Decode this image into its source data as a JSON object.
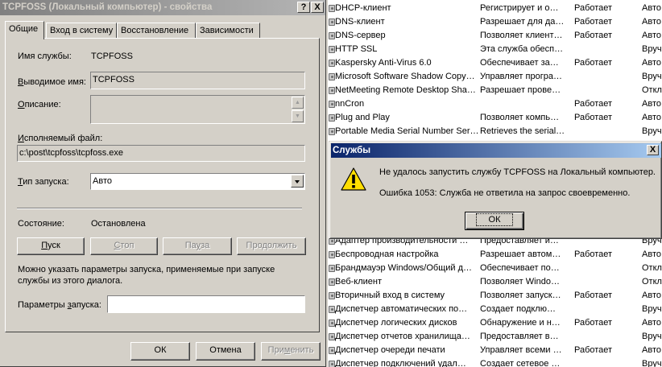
{
  "services": {
    "rows": [
      {
        "name": "DHCP-клиент",
        "desc": "Регистрирует и о…",
        "state": "Работает",
        "start": "Авто"
      },
      {
        "name": "DNS-клиент",
        "desc": "Разрешает для да…",
        "state": "Работает",
        "start": "Авто"
      },
      {
        "name": "DNS-сервер",
        "desc": "Позволяет клиент…",
        "state": "Работает",
        "start": "Авто"
      },
      {
        "name": "HTTP SSL",
        "desc": "Эта служба обесп…",
        "state": "",
        "start": "Вруч"
      },
      {
        "name": "Kaspersky Anti-Virus 6.0",
        "desc": "Обеспечивает за…",
        "state": "Работает",
        "start": "Авто"
      },
      {
        "name": "Microsoft Software Shadow Copy…",
        "desc": "Управляет програ…",
        "state": "",
        "start": "Вруч"
      },
      {
        "name": "NetMeeting Remote Desktop Sha…",
        "desc": "Разрешает прове…",
        "state": "",
        "start": "Откл"
      },
      {
        "name": "nnCron",
        "desc": "",
        "state": "Работает",
        "start": "Авто"
      },
      {
        "name": "Plug and Play",
        "desc": "Позволяет компь…",
        "state": "Работает",
        "start": "Авто"
      },
      {
        "name": "Portable Media Serial Number Ser…",
        "desc": "Retrieves the serial…",
        "state": "",
        "start": "Вруч"
      }
    ],
    "rows_bottom": [
      {
        "name": "Адаптер производительности …",
        "desc": "Предоставляет и…",
        "state": "",
        "start": "Вруч"
      },
      {
        "name": "Беспроводная настройка",
        "desc": "Разрешает автом…",
        "state": "Работает",
        "start": "Авто"
      },
      {
        "name": "Брандмауэр Windows/Общий д…",
        "desc": "Обеспечивает по…",
        "state": "",
        "start": "Откл"
      },
      {
        "name": "Веб-клиент",
        "desc": "Позволяет Windo…",
        "state": "",
        "start": "Откл"
      },
      {
        "name": "Вторичный вход в систему",
        "desc": "Позволяет запуск…",
        "state": "Работает",
        "start": "Авто"
      },
      {
        "name": "Диспетчер автоматических по…",
        "desc": "Создает подклю…",
        "state": "",
        "start": "Вруч"
      },
      {
        "name": "Диспетчер логических дисков",
        "desc": "Обнаружение и н…",
        "state": "Работает",
        "start": "Авто"
      },
      {
        "name": "Диспетчер отчетов хранилища…",
        "desc": "Предоставляет в…",
        "state": "",
        "start": "Вруч"
      },
      {
        "name": "Диспетчер очереди печати",
        "desc": "Управляет всеми …",
        "state": "Работает",
        "start": "Авто"
      },
      {
        "name": "Диспетчер подключений удал…",
        "desc": "Создает сетевое …",
        "state": "",
        "start": "Вруч"
      }
    ]
  },
  "properties": {
    "title": "TCPFOSS (Локальный компьютер) - свойства",
    "help_btn": "?",
    "close_btn": "X",
    "tabs": [
      {
        "label": "Общие"
      },
      {
        "label": "Вход в систему"
      },
      {
        "label": "Восстановление"
      },
      {
        "label": "Зависимости"
      }
    ],
    "service_name_label": "Имя службы:",
    "service_name_value": "TCPFOSS",
    "display_name_label_u": "В",
    "display_name_label_rest": "ыводимое имя:",
    "display_name_value": "TCPFOSS",
    "description_label_u": "О",
    "description_label_rest": "писание:",
    "exe_label_u": "И",
    "exe_label_rest": "сполняемый файл:",
    "exe_value": "c:\\post\\tcpfoss\\tcpfoss.exe",
    "startup_type_label_u": "Т",
    "startup_type_label_rest": "ип запуска:",
    "startup_type_value": "Авто",
    "status_label": "Состояние:",
    "status_value": "Остановлена",
    "btn_start_u": "П",
    "btn_start_rest": "уск",
    "btn_stop_u": "С",
    "btn_stop_rest": "топ",
    "btn_pause_pre": "Па",
    "btn_pause_u": "у",
    "btn_pause_rest": "за",
    "btn_resume_pre": "Про",
    "btn_resume_u": "д",
    "btn_resume_rest": "олжить",
    "hint_line1": "Можно указать параметры запуска, применяемые при запуске",
    "hint_line2": "службы из этого диалога.",
    "params_label_pre": "Параметры ",
    "params_label_u": "з",
    "params_label_rest": "апуска:",
    "params_value": "",
    "ok": "ОК",
    "cancel": "Отмена",
    "apply_pre": "При",
    "apply_u": "м",
    "apply_rest": "енить"
  },
  "error_dialog": {
    "title": "Службы",
    "close_btn": "X",
    "message": "Не удалось запустить службу TCPFOSS на Локальный компьютер.",
    "detail": "Ошибка 1053: Служба не ответила на запрос своевременно.",
    "ok": "ОК"
  },
  "colors": {
    "inactive_title": "#808080",
    "active_title": "#0a246a",
    "face": "#d4d0c8"
  }
}
